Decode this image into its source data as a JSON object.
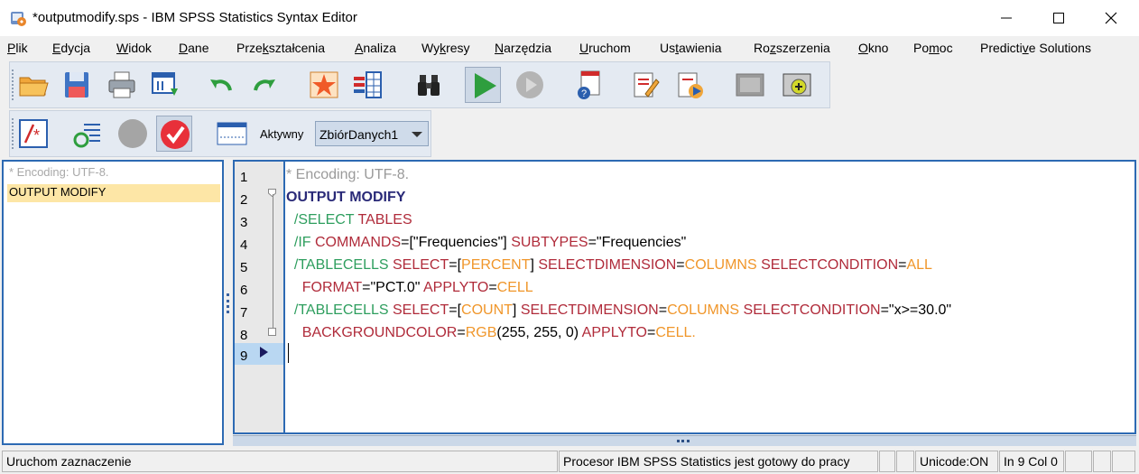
{
  "window": {
    "title": "*outputmodify.sps - IBM SPSS Statistics Syntax Editor",
    "minimize_icon": "minimize-icon",
    "maximize_icon": "maximize-icon",
    "close_icon": "close-icon"
  },
  "menu": [
    {
      "pre": "",
      "key": "P",
      "post": "lik"
    },
    {
      "pre": "",
      "key": "E",
      "post": "dycja"
    },
    {
      "pre": "",
      "key": "W",
      "post": "idok"
    },
    {
      "pre": "",
      "key": "D",
      "post": "ane"
    },
    {
      "pre": "Prze",
      "key": "k",
      "post": "ształcenia"
    },
    {
      "pre": "",
      "key": "A",
      "post": "naliza"
    },
    {
      "pre": "Wy",
      "key": "k",
      "post": "resy"
    },
    {
      "pre": "",
      "key": "N",
      "post": "arzędzia"
    },
    {
      "pre": "",
      "key": "U",
      "post": "ruchom"
    },
    {
      "pre": "Us",
      "key": "t",
      "post": "awienia"
    },
    {
      "pre": "Ro",
      "key": "z",
      "post": "szerzenia"
    },
    {
      "pre": "",
      "key": "O",
      "post": "kno"
    },
    {
      "pre": "Po",
      "key": "m",
      "post": "oc"
    },
    {
      "pre": "Predicti",
      "key": "v",
      "post": "e Solutions"
    }
  ],
  "toolbar": {
    "active_label": "Aktywny",
    "dataset_value": "ZbiórDanych1"
  },
  "navigator": {
    "items": [
      "* Encoding: UTF-8.",
      "OUTPUT MODIFY"
    ]
  },
  "editor": {
    "line_numbers": [
      "1",
      "2",
      "3",
      "4",
      "5",
      "6",
      "7",
      "8",
      "9"
    ],
    "lines": [
      [
        {
          "t": "* Encoding: UTF-8.",
          "c": "gray"
        }
      ],
      [
        {
          "t": "OUTPUT MODIFY",
          "c": "navy"
        }
      ],
      [
        {
          "t": "  /SELECT ",
          "c": "green"
        },
        {
          "t": "TABLES",
          "c": "red"
        }
      ],
      [
        {
          "t": "  /IF ",
          "c": "green"
        },
        {
          "t": "COMMANDS",
          "c": "red"
        },
        {
          "t": "=[\"Frequencies\"] ",
          "c": "black"
        },
        {
          "t": "SUBTYPES",
          "c": "red"
        },
        {
          "t": "=\"Frequencies\"",
          "c": "black"
        }
      ],
      [
        {
          "t": "  /TABLECELLS ",
          "c": "green"
        },
        {
          "t": "SELECT",
          "c": "red"
        },
        {
          "t": "=[",
          "c": "black"
        },
        {
          "t": "PERCENT",
          "c": "orange"
        },
        {
          "t": "] ",
          "c": "black"
        },
        {
          "t": "SELECTDIMENSION",
          "c": "red"
        },
        {
          "t": "=",
          "c": "black"
        },
        {
          "t": "COLUMNS",
          "c": "orange"
        },
        {
          "t": " ",
          "c": "black"
        },
        {
          "t": "SELECTCONDITION",
          "c": "red"
        },
        {
          "t": "=",
          "c": "black"
        },
        {
          "t": "ALL",
          "c": "orange"
        }
      ],
      [
        {
          "t": "    FORMAT",
          "c": "red"
        },
        {
          "t": "=\"PCT.0\" ",
          "c": "black"
        },
        {
          "t": "APPLYTO",
          "c": "red"
        },
        {
          "t": "=",
          "c": "black"
        },
        {
          "t": "CELL",
          "c": "orange"
        }
      ],
      [
        {
          "t": "  /TABLECELLS ",
          "c": "green"
        },
        {
          "t": "SELECT",
          "c": "red"
        },
        {
          "t": "=[",
          "c": "black"
        },
        {
          "t": "COUNT",
          "c": "orange"
        },
        {
          "t": "] ",
          "c": "black"
        },
        {
          "t": "SELECTDIMENSION",
          "c": "red"
        },
        {
          "t": "=",
          "c": "black"
        },
        {
          "t": "COLUMNS",
          "c": "orange"
        },
        {
          "t": " ",
          "c": "black"
        },
        {
          "t": "SELECTCONDITION",
          "c": "red"
        },
        {
          "t": "=\"x>=30.0\"",
          "c": "black"
        }
      ],
      [
        {
          "t": "    BACKGROUNDCOLOR",
          "c": "red"
        },
        {
          "t": "=",
          "c": "black"
        },
        {
          "t": "RGB",
          "c": "orange"
        },
        {
          "t": "(255, 255, 0) ",
          "c": "black"
        },
        {
          "t": "APPLYTO",
          "c": "red"
        },
        {
          "t": "=",
          "c": "black"
        },
        {
          "t": "CELL.",
          "c": "orange"
        }
      ],
      []
    ]
  },
  "status": {
    "left": "Uruchom zaznaczenie",
    "processor": "Procesor IBM SPSS Statistics  jest gotowy do pracy",
    "unicode": "Unicode:ON",
    "position": "In 9 Col 0"
  },
  "colors": {
    "accent": "#2d6ab3",
    "selection": "#fde6a6",
    "current_line": "#b9d7f2"
  }
}
